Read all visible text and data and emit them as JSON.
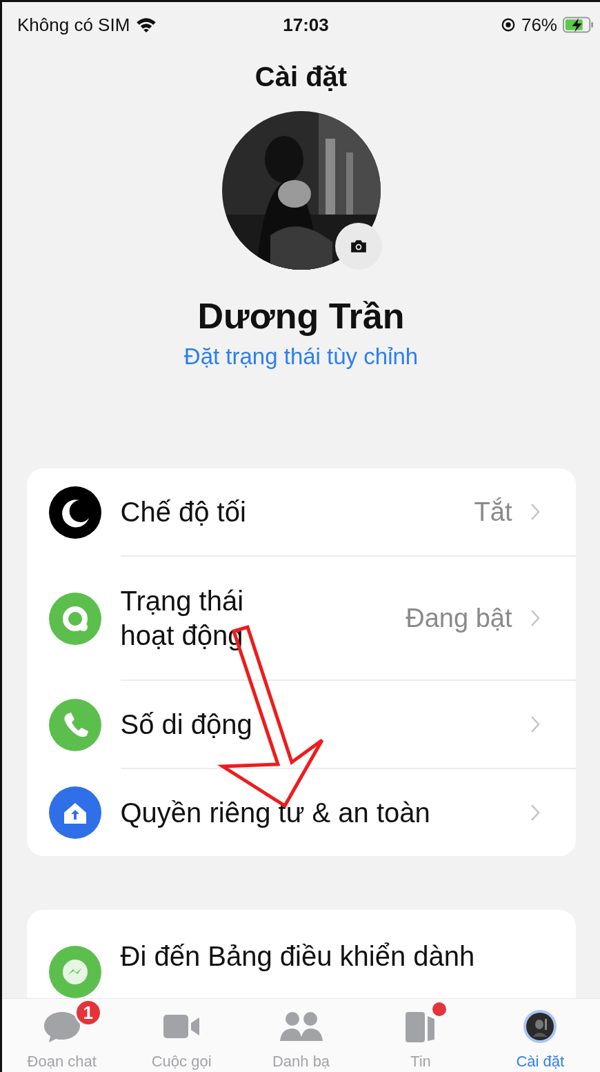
{
  "status_bar": {
    "carrier": "Không có SIM",
    "time": "17:03",
    "battery": "76%"
  },
  "title": "Cài đặt",
  "profile": {
    "name": "Dương Trần",
    "status_link": "Đặt trạng thái tùy chỉnh"
  },
  "settings": [
    {
      "kind": "moon",
      "label": "Chế độ tối",
      "value": "Tắt"
    },
    {
      "kind": "status",
      "label": "Trạng thái hoạt động",
      "value": "Đang bật"
    },
    {
      "kind": "phone",
      "label": "Số di động"
    },
    {
      "kind": "privacy",
      "label": "Quyền riêng tư & an toàn"
    }
  ],
  "more": [
    {
      "kind": "messenger",
      "label": "Đi đến Bảng điều khiển dành"
    }
  ],
  "tabs": [
    {
      "kind": "chat",
      "label": "Đoạn chat",
      "badge": "1",
      "dot": false,
      "selected": false
    },
    {
      "kind": "video",
      "label": "Cuộc gọi",
      "dot": false,
      "selected": false
    },
    {
      "kind": "people",
      "label": "Danh bạ",
      "dot": false,
      "selected": false
    },
    {
      "kind": "stories",
      "label": "Tin",
      "dot": true,
      "selected": false
    },
    {
      "kind": "avatar",
      "label": "Cài đặt",
      "dot": false,
      "selected": true
    }
  ]
}
